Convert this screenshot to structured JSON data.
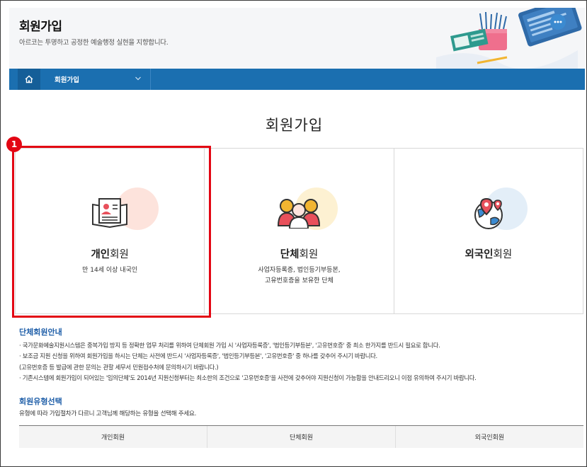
{
  "header": {
    "title": "회원가입",
    "subtitle": "아르코는 투명하고 공정한 예술행정 실현을 지향합니다."
  },
  "nav": {
    "menu_label": "회원가입"
  },
  "page_title": "회원가입",
  "badge_number": "1",
  "cards": [
    {
      "name_bold": "개인",
      "name_rest": "회원",
      "desc_lines": [
        "만 14세 이상 내국인"
      ],
      "circle_color": "#fde3dc"
    },
    {
      "name_bold": "단체",
      "name_rest": "회원",
      "desc_lines": [
        "사업자등록증, 법인등기부등본,",
        "고유번호증을 보유한 단체"
      ],
      "circle_color": "#fdf1d2"
    },
    {
      "name_bold": "외국인",
      "name_rest": "회원",
      "desc_lines": [],
      "circle_color": "#e3eef8"
    }
  ],
  "group_info": {
    "title": "단체회원안내",
    "lines": [
      "· 국가문화예술지원시스템은 중복가입 방지 등 정확한 업무 처리를 위하여 단체회원 가입 시 '사업자등록증', '법인등기부등본', '고유번호증' 중 최소 한가지를 반드시 필요로 합니다.",
      "· 보조금 지원 신청을 위하여 회원가입을 하시는 단체는 사전에 반드시 '사업자등록증', '법인등기부등본', '고유번호증' 중 하나를 갖추어 주시기 바랍니다.",
      "  (고유번호증 등 발급에 관한 문의는 관할 세무서 민원접수처에 문의하시기 바랍니다.)",
      "· 기존시스템에 회원가입이 되어있는 '임의단체'도 2014년 지원신청부터는 최소한의 조건으로 '고유번호증'을 사전에 갖추어야 지원신청이 가능함을 안내드리오니 이점 유의하여 주시기 바랍니다."
    ]
  },
  "type_select": {
    "title": "회원유형선택",
    "guide": "유형에 따라 가입절차가 다르니 고객님께 해당하는 유형을 선택해 주세요.",
    "columns": [
      "개인회원",
      "단체회원",
      "외국인회원"
    ]
  }
}
